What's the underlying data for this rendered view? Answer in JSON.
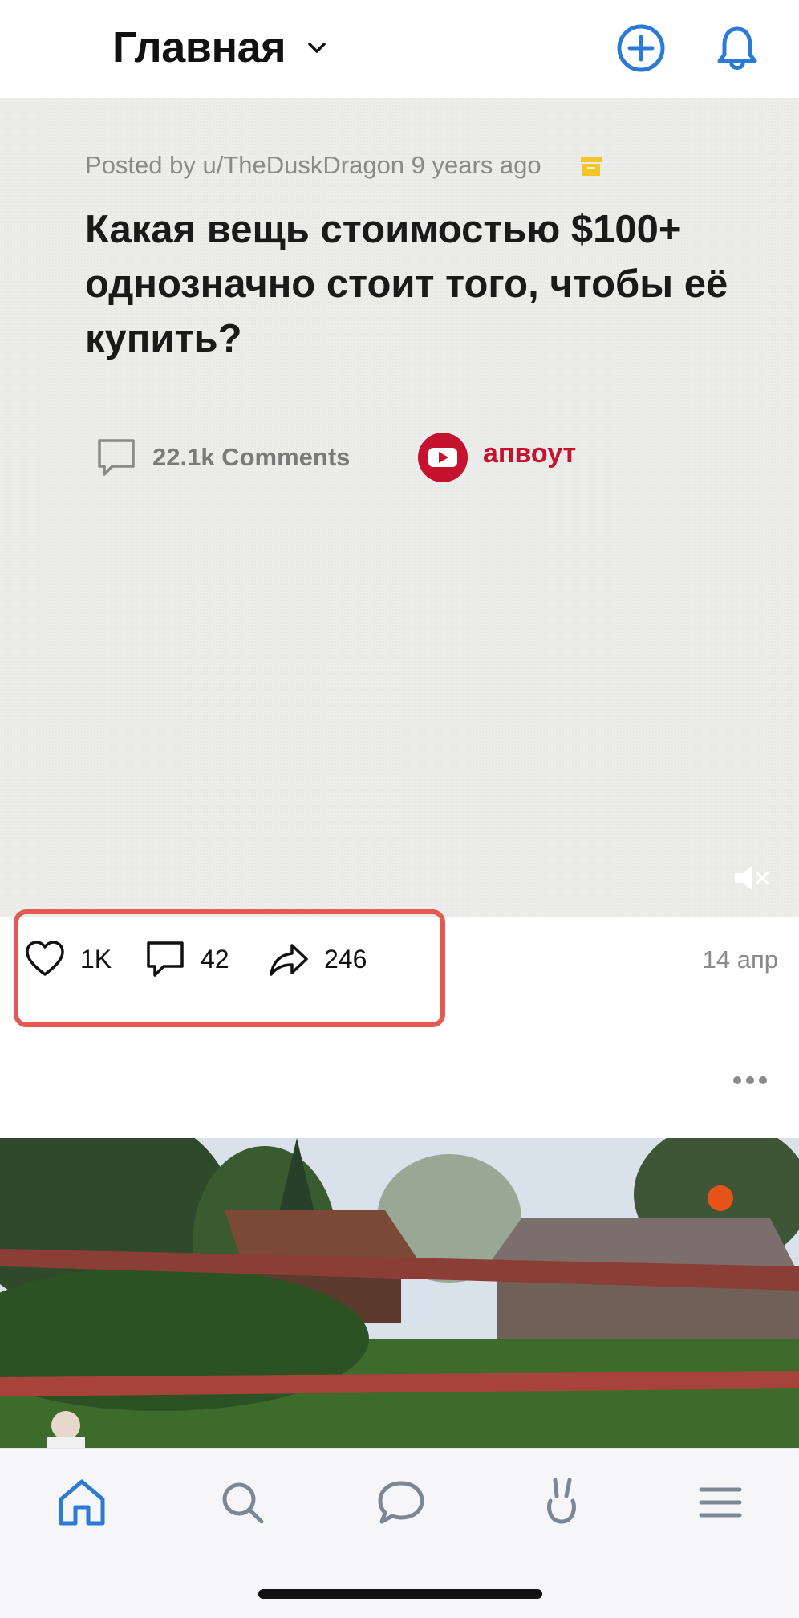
{
  "header": {
    "title": "Главная",
    "icons": [
      "chevron-down-icon",
      "add-circle-icon",
      "bell-icon"
    ],
    "accent_color": "#2b7bd6"
  },
  "post": {
    "posted_by": "Posted by u/TheDuskDragon 9 years ago",
    "title": "Какая вещь стоимостью $100+ однозначно стоит того, чтобы её купить?",
    "comments_count": "22.1k Comments",
    "brand_label": "апвоут",
    "brand_color": "#c4122f"
  },
  "actions": {
    "likes": "1K",
    "comments": "42",
    "shares": "246",
    "date": "14 апр",
    "highlight_color": "#e25a52"
  },
  "nav": {
    "items": [
      "home-icon",
      "search-icon",
      "chat-icon",
      "bunny-icon",
      "menu-icon"
    ],
    "active": "home-icon"
  }
}
